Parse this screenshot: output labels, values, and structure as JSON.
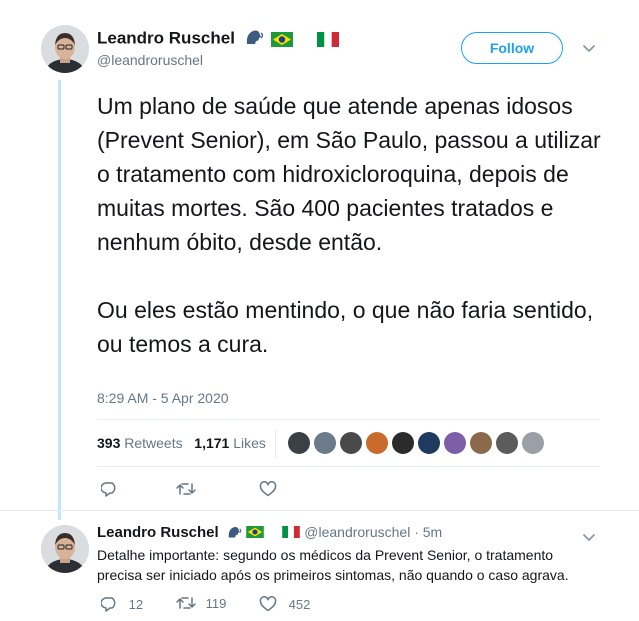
{
  "main_tweet": {
    "author_name": "Leandro Ruschel",
    "handle": "@leandroruschel",
    "follow_label": "Follow",
    "text": "Um plano de saúde que atende apenas idosos (Prevent Senior), em São Paulo, passou a utilizar o tratamento com hidroxicloroquina, depois de muitas mortes. São 400 pacientes tratados e nenhum óbito, desde então.\n\nOu eles estão mentindo, o que não faria sentido, ou temos a cura.",
    "timestamp": "8:29 AM - 5 Apr 2020",
    "retweets_count": "393",
    "retweets_label": "Retweets",
    "likes_count": "1,171",
    "likes_label": "Likes",
    "liker_colors": [
      "#3b3f46",
      "#6b7b8c",
      "#4a4a4a",
      "#c96b2a",
      "#2b2b2b",
      "#1e3a5f",
      "#7d5fa8",
      "#8a6a4a",
      "#5c5c5c",
      "#9aa0a6"
    ]
  },
  "reply_tweet": {
    "author_name": "Leandro Ruschel",
    "handle": "@leandroruschel",
    "time": "5m",
    "separator": "·",
    "text": "Detalhe importante: segundo os médicos da Prevent Senior, o tratamento precisa ser iniciado após os primeiros sintomas, não quando o caso agrava.",
    "reply_count": "12",
    "retweet_count": "119",
    "like_count": "452"
  },
  "colors": {
    "accent": "#1da1f2",
    "muted": "#657786",
    "thread_line": "#c4e5f8"
  }
}
